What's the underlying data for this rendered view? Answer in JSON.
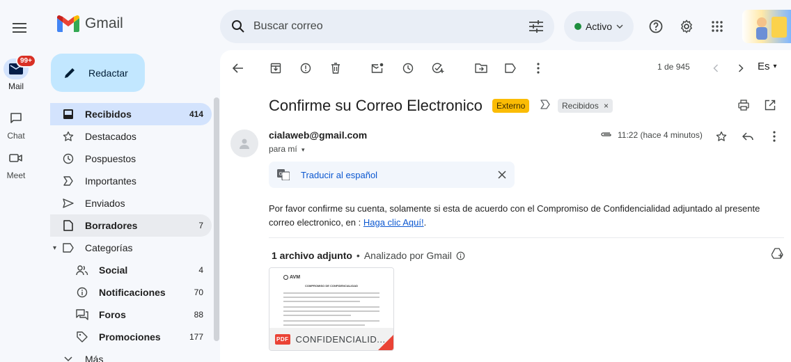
{
  "app": {
    "name": "Gmail"
  },
  "search": {
    "placeholder": "Buscar correo"
  },
  "status": {
    "label": "Activo"
  },
  "rail": {
    "mail_label": "Mail",
    "mail_badge": "99+",
    "chat_label": "Chat",
    "meet_label": "Meet"
  },
  "compose": {
    "label": "Redactar"
  },
  "nav": {
    "items": [
      {
        "label": "Recibidos",
        "count": "414"
      },
      {
        "label": "Destacados",
        "count": ""
      },
      {
        "label": "Pospuestos",
        "count": ""
      },
      {
        "label": "Importantes",
        "count": ""
      },
      {
        "label": "Enviados",
        "count": ""
      },
      {
        "label": "Borradores",
        "count": "7"
      },
      {
        "label": "Categorías",
        "count": ""
      },
      {
        "label": "Social",
        "count": "4"
      },
      {
        "label": "Notificaciones",
        "count": "70"
      },
      {
        "label": "Foros",
        "count": "88"
      },
      {
        "label": "Promociones",
        "count": "177"
      },
      {
        "label": "Más",
        "count": ""
      }
    ]
  },
  "toolbar": {
    "pagination": "1 de 945",
    "lang": "Es"
  },
  "email": {
    "subject": "Confirme su Correo Electronico",
    "tag_external": "Externo",
    "tag_inbox": "Recibidos",
    "sender": "cialaweb@gmail.com",
    "to": "para mí",
    "time": "11:22 (hace 4 minutos)",
    "translate_label": "Traducir al español",
    "body_before": "Por favor confirme su cuenta, solamente si esta de acuerdo con el Compromiso de Confidencialidad adjuntado al presente correo electronico, en : ",
    "body_link": "Haga clic Aquí!",
    "body_after": ".",
    "attachments_title": "1 archivo adjunto",
    "attachments_scan": "Analizado por Gmail",
    "attachment_name": "CONFIDENCIALID...",
    "attachment_pdf": "PDF",
    "attachment_preview_logo": "AVM",
    "attachment_preview_title": "COMPROMISO DE CONFIDENCIALIDAD"
  },
  "colors": {
    "accent": "#0b57d0",
    "compose_bg": "#c2e7ff",
    "active_nav": "#d3e3fd",
    "external_tag": "#fbbc04",
    "badge": "#d93025"
  }
}
